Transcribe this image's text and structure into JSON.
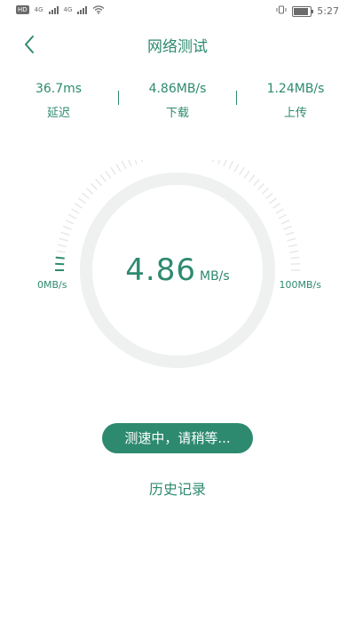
{
  "status_bar": {
    "hd_label": "HD",
    "network_1": "4G",
    "network_2": "4G",
    "time": "5:27"
  },
  "header": {
    "title": "网络测试"
  },
  "stats": [
    {
      "value": "36.7ms",
      "label": "延迟"
    },
    {
      "value": "4.86MB/s",
      "label": "下载"
    },
    {
      "value": "1.24MB/s",
      "label": "上传"
    }
  ],
  "gauge": {
    "speed_value": "4.86",
    "speed_unit": "MB/s",
    "min_label": "0MB/s",
    "max_label": "100MB/s",
    "progress_fraction": 0.05
  },
  "actions": {
    "testing_label": "测速中，请稍等...",
    "history_label": "历史记录"
  },
  "colors": {
    "accent": "#2e8a6f",
    "ring_track": "#eef1f0",
    "tick_inactive": "#e6e9e8"
  }
}
